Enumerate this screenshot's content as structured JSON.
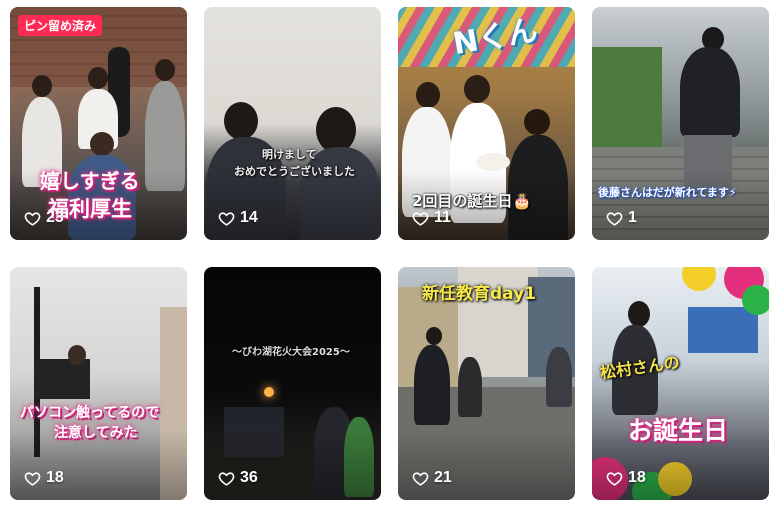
{
  "tiles": [
    {
      "likes": "23",
      "pin_label": "ピン留め済み",
      "caption_line1": "嬉しすぎる",
      "caption_line2": "福利厚生"
    },
    {
      "likes": "14",
      "caption_line1": "明けまして",
      "caption_line2": "おめでとうございました"
    },
    {
      "likes": "11",
      "caption_top": "Nくん",
      "caption_bottom": "2回目の誕生日🎂"
    },
    {
      "likes": "1",
      "caption_bottom": "後藤さんはだが新れてます⚡"
    },
    {
      "likes": "18",
      "caption_line1": "パソコン触ってるので",
      "caption_line2": "注意してみた"
    },
    {
      "likes": "36",
      "caption_top": "〜びわ湖花火大会2025〜"
    },
    {
      "likes": "21",
      "caption_top": "新任教育day1"
    },
    {
      "likes": "18",
      "caption_line1": "松村さんの",
      "caption_line2": "お誕生日"
    }
  ],
  "icons": {
    "like": "heart-outline-icon"
  },
  "colors": {
    "pin_badge": "#fe2c55",
    "pink_glow": "#e0338a"
  }
}
